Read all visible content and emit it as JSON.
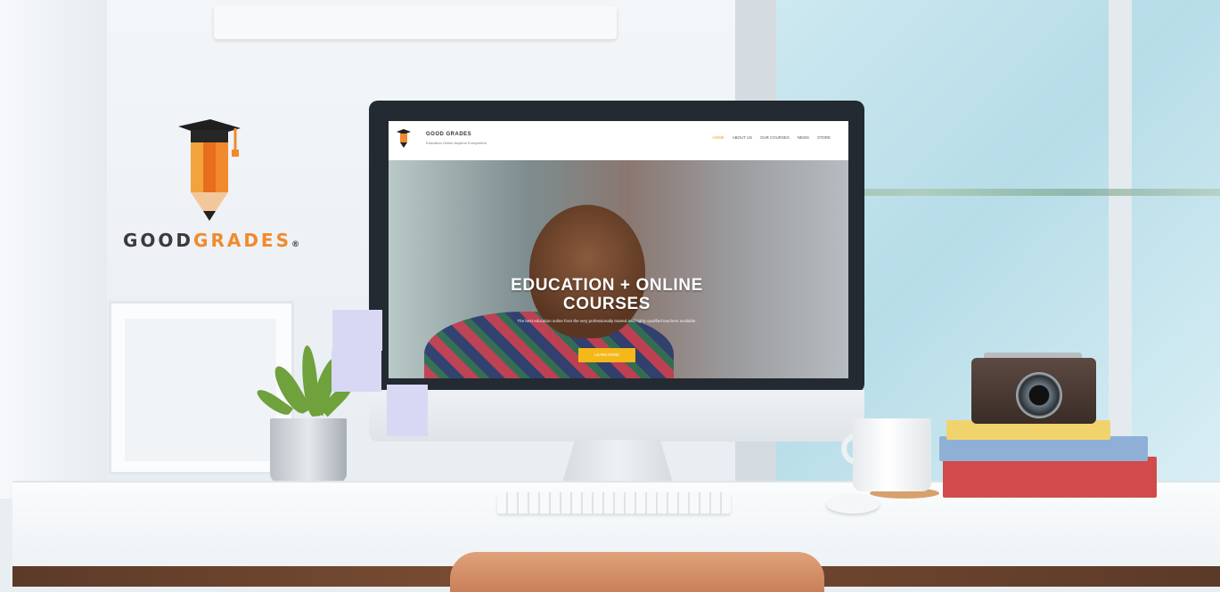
{
  "brand": {
    "word1": "GOOD",
    "word2": "GRADES",
    "mark": "®"
  },
  "website": {
    "site_name": "GOOD GRADES",
    "tagline": "Education Online Anytime Everywhere",
    "nav": [
      {
        "label": "HOME",
        "active": true
      },
      {
        "label": "ABOUT US",
        "active": false
      },
      {
        "label": "OUR COURSES",
        "active": false
      },
      {
        "label": "NEWS",
        "active": false
      },
      {
        "label": "STORE",
        "active": false
      }
    ],
    "hero": {
      "title": "EDUCATION + ONLINE COURSES",
      "subtitle": "The best education online from the very professionally trained and highly qualified teachers available.",
      "button": "LEARN MORE"
    }
  },
  "colors": {
    "brand_orange": "#f08a2c",
    "brand_dark": "#3b3b3b",
    "button_yellow": "#f5b81a",
    "nav_active": "#f0a21c"
  }
}
